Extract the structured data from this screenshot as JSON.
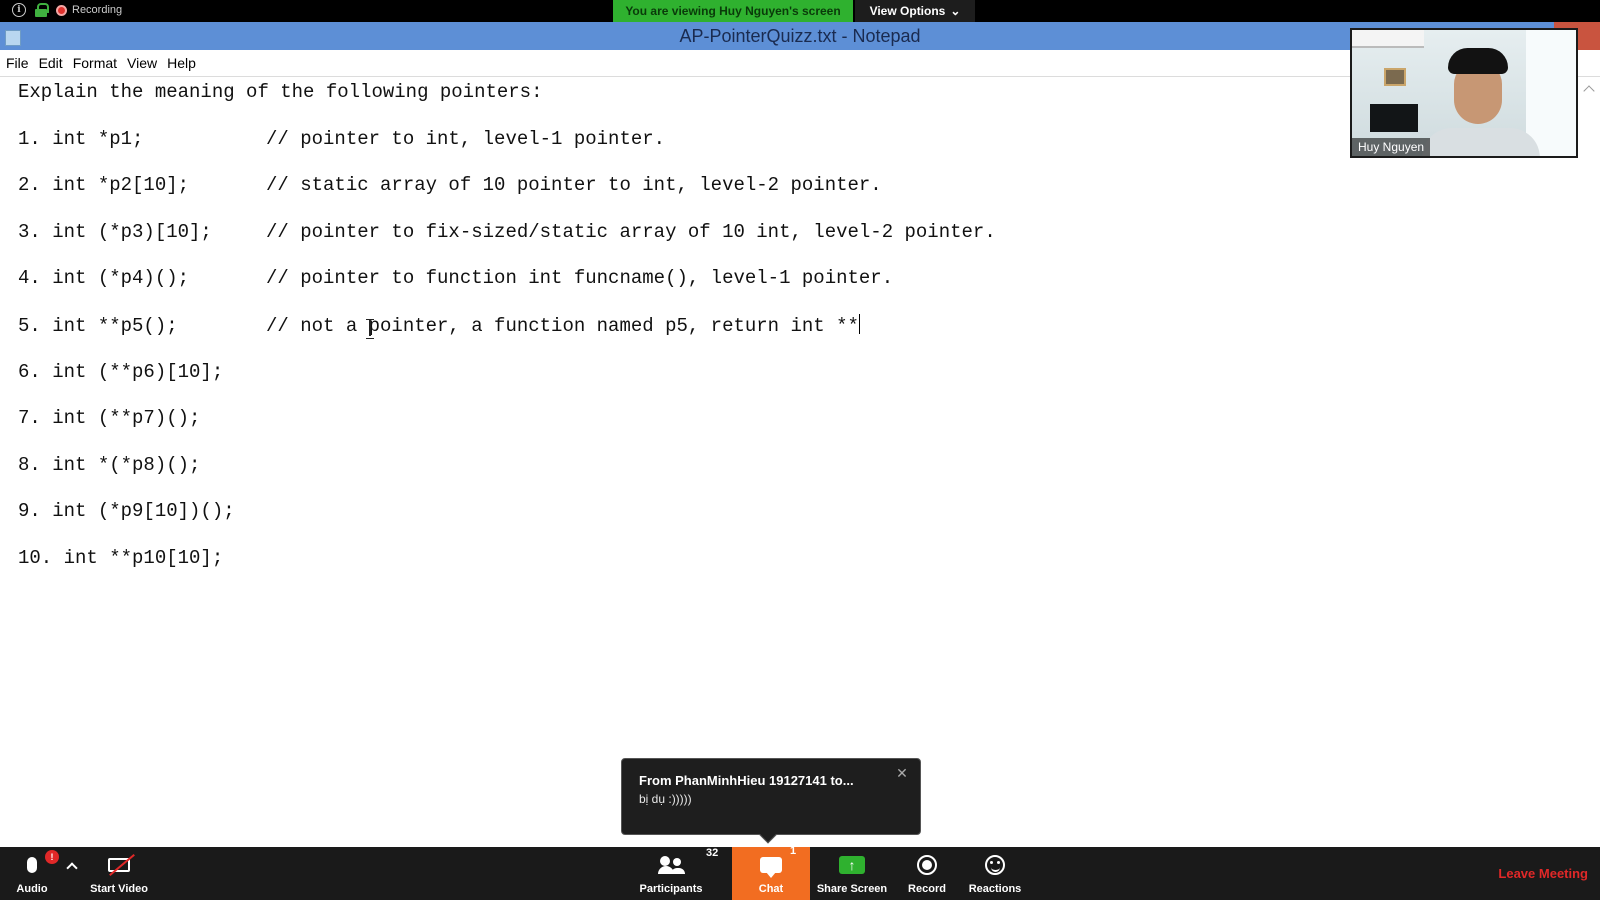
{
  "zoom_top": {
    "recording_label": "Recording",
    "viewing_banner": "You are viewing Huy Nguyen's screen",
    "view_options_label": "View Options"
  },
  "notepad": {
    "title": "AP-PointerQuizz.txt - Notepad",
    "menu": [
      "File",
      "Edit",
      "Format",
      "View",
      "Help"
    ],
    "heading": "Explain the meaning of the following pointers:",
    "lines": [
      {
        "code": "1. int *p1;",
        "comment": "// pointer to int, level-1 pointer."
      },
      {
        "code": "2. int *p2[10];",
        "comment": "// static array of 10 pointer to int, level-2 pointer."
      },
      {
        "code": "3. int (*p3)[10];",
        "comment": "// pointer to fix-sized/static array of 10 int, level-2 pointer."
      },
      {
        "code": "4. int (*p4)();",
        "comment": "// pointer to function int funcname(), level-1 pointer."
      },
      {
        "code": "5. int **p5();",
        "comment": "// not a pointer, a function named p5, return int **"
      },
      {
        "code": "6. int (**p6)[10];",
        "comment": ""
      },
      {
        "code": "7. int (**p7)();",
        "comment": ""
      },
      {
        "code": "8. int *(*p8)();",
        "comment": ""
      },
      {
        "code": "9. int (*p9[10])();",
        "comment": ""
      },
      {
        "code": "10. int **p10[10];",
        "comment": ""
      }
    ]
  },
  "video": {
    "participant_name": "Huy Nguyen"
  },
  "chat_popup": {
    "from": "From  PhanMinhHieu  19127141  to...",
    "message": "bị dụ :)))))"
  },
  "toolbar": {
    "audio_label": "Audio",
    "audio_badge": "!",
    "start_video_label": "Start Video",
    "participants_label": "Participants",
    "participants_count": "32",
    "chat_label": "Chat",
    "chat_badge": "1",
    "share_screen_label": "Share Screen",
    "record_label": "Record",
    "reactions_label": "Reactions",
    "leave_label": "Leave Meeting"
  },
  "colors": {
    "titlebar": "#5d8fd6",
    "viewing_banner": "#2fb12f",
    "chat_active": "#f26d21",
    "leave": "#e02828"
  }
}
